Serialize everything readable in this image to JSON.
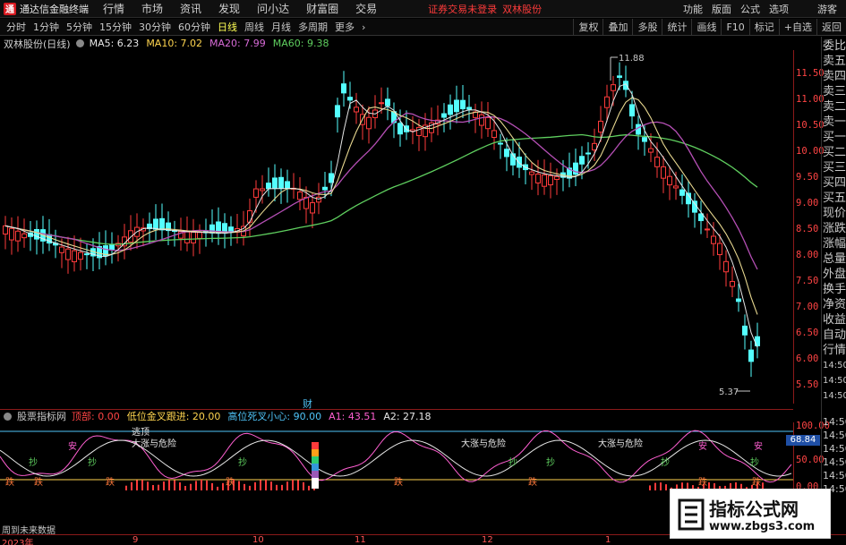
{
  "app": {
    "title": "通达信金融终端",
    "logo_char": "通"
  },
  "menu": [
    "行情",
    "市场",
    "资讯",
    "发现",
    "问小达",
    "财富圈",
    "交易"
  ],
  "status": {
    "message": "证券交易未登录",
    "stock": "双林股份"
  },
  "right_menu": [
    "功能",
    "版面",
    "公式",
    "选项"
  ],
  "guest": "游客",
  "periods": [
    "分时",
    "1分钟",
    "5分钟",
    "15分钟",
    "30分钟",
    "60分钟",
    "日线",
    "周线",
    "月线",
    "多周期",
    "更多"
  ],
  "active_period": "日线",
  "tools": [
    "复权",
    "叠加",
    "多股",
    "统计",
    "画线",
    "F10",
    "标记",
    "+自选",
    "返回"
  ],
  "chart": {
    "stock_title": "双林股份(日线)",
    "ma": [
      {
        "label": "MA5: 6.23",
        "color": "#e6e6e6"
      },
      {
        "label": "MA10: 7.02",
        "color": "#ffd54f"
      },
      {
        "label": "MA20: 7.99",
        "color": "#d86bd8"
      },
      {
        "label": "MA60: 9.38",
        "color": "#5fcf5f"
      }
    ],
    "high_label": "11.88",
    "low_label": "5.37",
    "cai": "财",
    "price_ticks": [
      "11.50",
      "11.00",
      "10.50",
      "10.00",
      "9.50",
      "9.00",
      "8.50",
      "8.00",
      "7.50",
      "7.00",
      "6.50",
      "6.00",
      "5.50"
    ]
  },
  "side_panel": [
    "委比",
    "卖五",
    "卖四",
    "卖三",
    "卖二",
    "卖一",
    "买一",
    "买二",
    "买三",
    "买四",
    "买五",
    "现价",
    "涨跌",
    "涨幅",
    "总量",
    "外盘",
    "换手",
    "净资",
    "收益",
    "自动",
    "行情",
    "14:50",
    "14:50",
    "14:50"
  ],
  "indicator": {
    "title": "股票指标网",
    "values": [
      {
        "label": "顶部: 0.00",
        "color": "#ff4444"
      },
      {
        "label": "低位金叉跟进: 20.00",
        "color": "#ffd54f"
      },
      {
        "label": "高位死叉小心: 90.00",
        "color": "#4fc3f7"
      },
      {
        "label": "A1: 43.51",
        "color": "#ff5fd2"
      },
      {
        "label": "A2: 27.18",
        "color": "#e6e6e6"
      }
    ],
    "axis": [
      "100.00",
      "50.00",
      "0.00"
    ],
    "badge": "68.84",
    "annotations": [
      "逃顶",
      "大涨与危险",
      "大涨与危险",
      "大涨与危险"
    ],
    "buy_labels": [
      "抄",
      "抄",
      "抄",
      "抄",
      "抄",
      "抄",
      "抄"
    ],
    "dian_labels": [
      "跌",
      "跌",
      "跌",
      "跌",
      "跌",
      "跌",
      "跌",
      "跌"
    ],
    "an_labels": [
      "安",
      "安",
      "安"
    ],
    "side": [
      "14:50",
      "14:50",
      "14:50",
      "14:50",
      "14:50",
      "14:50"
    ]
  },
  "future_note": "周到未来数据",
  "time_axis": [
    "2023年",
    "9",
    "10",
    "11",
    "12",
    "1"
  ],
  "watermark": {
    "title": "指标公式网",
    "url": "www.zbgs3.com"
  }
}
